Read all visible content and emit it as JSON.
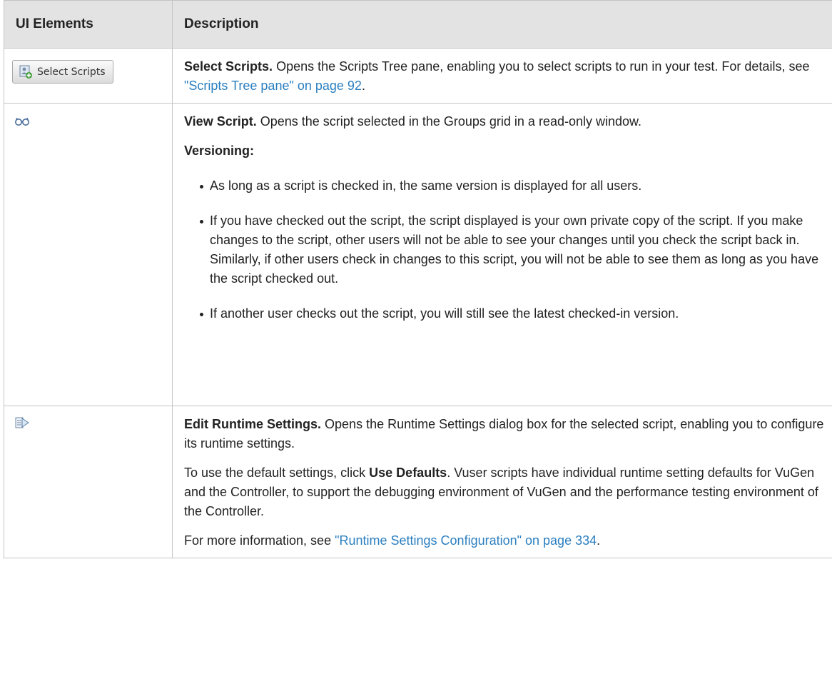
{
  "table": {
    "headers": {
      "ui_elements": "UI Elements",
      "description": "Description"
    },
    "rows": [
      {
        "element": {
          "type": "button",
          "icon": "select-scripts-icon",
          "label": "Select Scripts"
        },
        "title": "Select Scripts.",
        "text": "Opens the Scripts Tree pane, enabling you to select scripts to run in your test. For details, see",
        "link": "\"Scripts Tree pane\" on page 92",
        "text_after": "."
      },
      {
        "element": {
          "type": "icon",
          "icon": "view-script-glasses-icon"
        },
        "title": "View Script.",
        "text": "Opens the script selected in the Groups grid in a read-only window.",
        "subheading": "Versioning:",
        "bullets": [
          "As long as a script is checked in, the same version is displayed for all users.",
          "If you have checked out the script, the script displayed is your own private copy of the script. If you make changes to the script, other users will not be able to see your changes until you check the script back in. Similarly, if other users check in changes to this script, you will not be able to see them as long as you have the script checked out.",
          "If another user checks out the script, you will still see the latest checked-in version."
        ]
      },
      {
        "element": {
          "type": "icon",
          "icon": "edit-runtime-settings-icon"
        },
        "title": "Edit Runtime Settings.",
        "text": "Opens the Runtime Settings dialog box for the selected script, enabling you to configure its runtime settings.",
        "para2_before": "To use the default settings, click",
        "para2_bold": "Use Defaults",
        "para2_after": ". Vuser scripts have individual runtime setting defaults for VuGen and the Controller, to support the debugging environment of VuGen and the performance testing environment of the Controller.",
        "para3_before": "For more information, see",
        "para3_link": "\"Runtime Settings Configuration\" on page 334",
        "para3_after": "."
      }
    ]
  },
  "colors": {
    "header_bg": "#e3e3e3",
    "border": "#c4c4c4",
    "link": "#2b7fc0"
  }
}
